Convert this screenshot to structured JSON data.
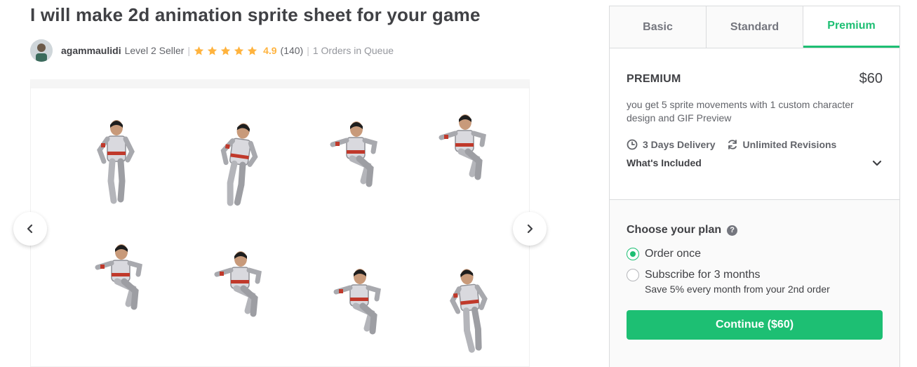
{
  "gig": {
    "title": "I will make 2d animation sprite sheet for your game"
  },
  "seller": {
    "username": "agammaulidi",
    "level": "Level 2 Seller",
    "separator": "|",
    "rating": "4.9",
    "reviews": "(140)",
    "queue": "1 Orders in Queue",
    "star_color": "#ffb33e"
  },
  "gallery": {
    "prev_icon": "chevron-left-icon",
    "next_icon": "chevron-right-icon"
  },
  "package": {
    "tabs": [
      {
        "label": "Basic",
        "active": false
      },
      {
        "label": "Standard",
        "active": false
      },
      {
        "label": "Premium",
        "active": true
      }
    ],
    "name": "PREMIUM",
    "price": "$60",
    "description": "you get 5 sprite movements with 1 custom character design and GIF Preview",
    "delivery": "3 Days Delivery",
    "revisions": "Unlimited Revisions",
    "included_label": "What's Included"
  },
  "plan": {
    "title": "Choose your plan",
    "options": [
      {
        "label": "Order once",
        "checked": true
      },
      {
        "label": "Subscribe for 3 months",
        "sub": "Save 5% every month from your 2nd order",
        "checked": false
      }
    ],
    "continue_label": "Continue ($60)"
  },
  "colors": {
    "accent": "#1dbf73",
    "text": "#404145",
    "muted": "#62646a"
  }
}
